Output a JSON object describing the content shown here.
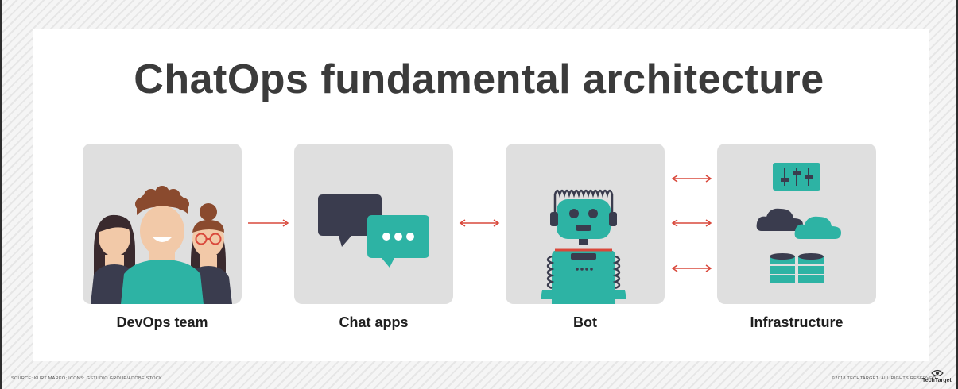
{
  "title": "ChatOps fundamental architecture",
  "nodes": [
    {
      "id": "devops",
      "label": "DevOps team"
    },
    {
      "id": "chat",
      "label": "Chat apps"
    },
    {
      "id": "bot",
      "label": "Bot"
    },
    {
      "id": "infra",
      "label": "Infrastructure"
    }
  ],
  "icons": [
    "people-icon",
    "speech-bubbles-icon",
    "robot-icon",
    "control-panel-icon",
    "cloud-icon",
    "database-icon"
  ],
  "connections": [
    {
      "from": "DevOps team",
      "to": "Chat apps",
      "direction": "one-way"
    },
    {
      "from": "Chat apps",
      "to": "Bot",
      "direction": "two-way"
    },
    {
      "from": "Bot",
      "to": "Infrastructure",
      "direction": "two-way",
      "count": 3
    }
  ],
  "footer": {
    "source": "SOURCE: KURT MARKO; ICONS: GSTUDIO GROUP/ADOBE STOCK",
    "copyright": "©2018 TECHTARGET. ALL RIGHTS RESERVED",
    "brand": "TechTarget"
  },
  "colors": {
    "teal": "#2db3a4",
    "dark": "#3a3c4e",
    "arrow": "#d9483b",
    "tile": "#dfdfdf",
    "title": "#3b3b3b"
  }
}
